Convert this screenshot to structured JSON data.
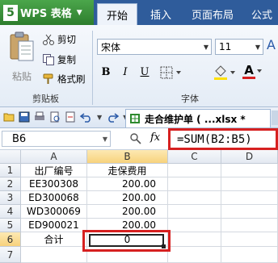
{
  "app": {
    "name": "WPS 表格",
    "logo_glyph": "5",
    "caret": "▼"
  },
  "menu_tabs": [
    {
      "label": "开始",
      "active": true
    },
    {
      "label": "插入",
      "active": false
    },
    {
      "label": "页面布局",
      "active": false
    },
    {
      "label": "公式",
      "active": false
    }
  ],
  "ribbon": {
    "clipboard": {
      "paste_label": "粘贴",
      "cut_label": "剪切",
      "copy_label": "复制",
      "format_painter_label": "格式刷",
      "group_label": "剪贴板"
    },
    "font": {
      "font_name": "宋体",
      "font_size": "11",
      "bold_glyph": "B",
      "italic_glyph": "I",
      "underline_glyph": "U",
      "font_color_glyph": "A",
      "group_label": "字体",
      "font_color": "#d62020"
    }
  },
  "document_tab": {
    "title": "走合维护单 ( ...xlsx *"
  },
  "formula_bar": {
    "cell_ref": "B6",
    "fx_glyph": "fx",
    "formula": "=SUM(B2:B5)"
  },
  "sheet": {
    "columns": [
      "A",
      "B",
      "C",
      "D"
    ],
    "rows": [
      {
        "num": "1",
        "a": "出厂编号",
        "b": "走保费用"
      },
      {
        "num": "2",
        "a": "EE300308",
        "b": "200.00"
      },
      {
        "num": "3",
        "a": "ED300068",
        "b": "200.00"
      },
      {
        "num": "4",
        "a": "WD300069",
        "b": "200.00"
      },
      {
        "num": "5",
        "a": "ED900021",
        "b": "200.00"
      },
      {
        "num": "6",
        "a": "合计",
        "b": "0"
      },
      {
        "num": "7",
        "a": "",
        "b": ""
      }
    ]
  },
  "colors": {
    "title_bar": "#2f5c9b",
    "app_button": "#2d7d2d",
    "highlight_box": "#d62020",
    "selected_header": "#f7d27c"
  }
}
